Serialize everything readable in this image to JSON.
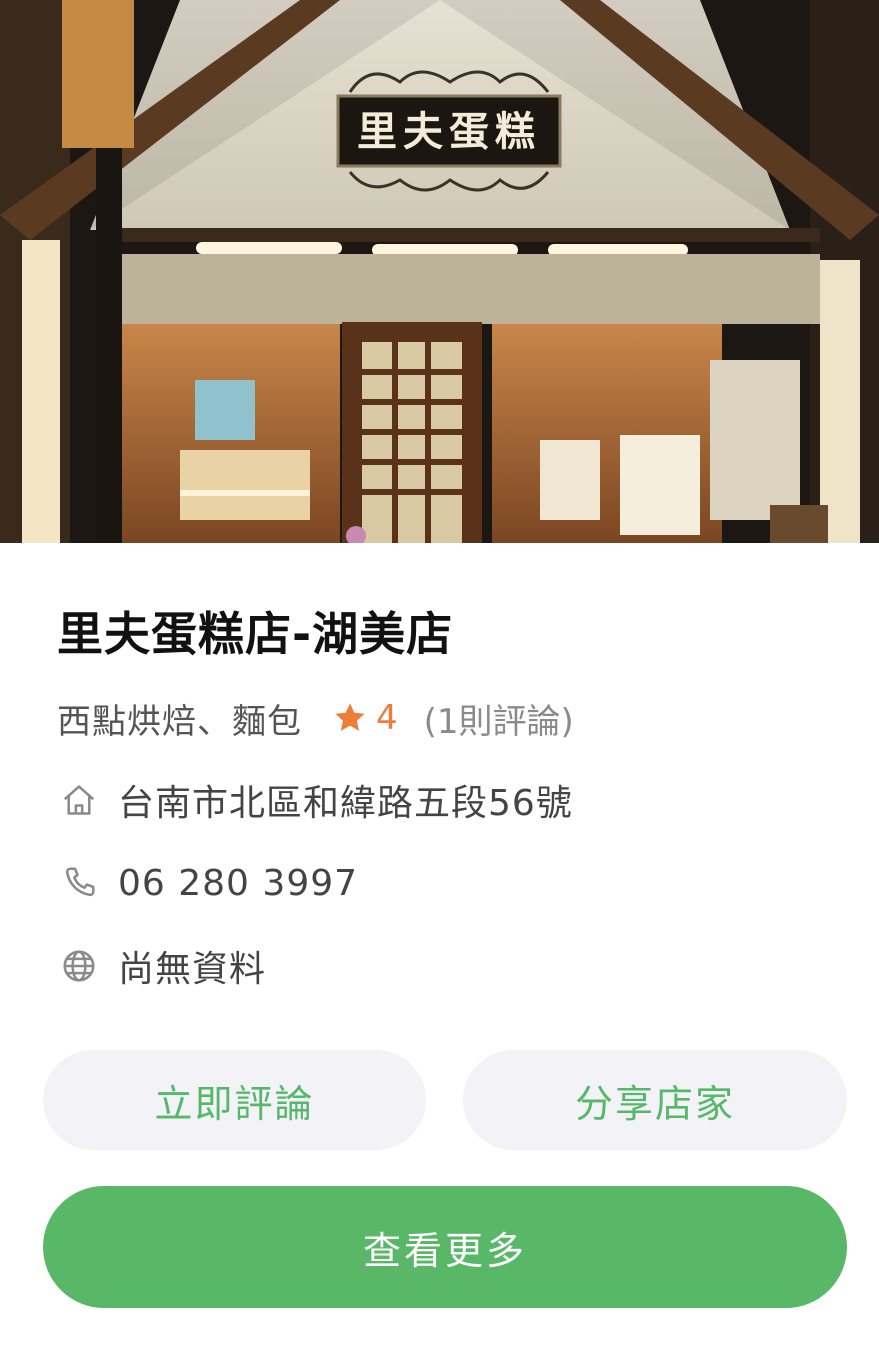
{
  "store": {
    "sign_text": "里夫蛋糕",
    "name": "里夫蛋糕店-湖美店",
    "category": "西點烘焙、麵包",
    "rating": "4",
    "review_count": "(1則評論)",
    "address": "台南市北區和緯路五段56號",
    "phone": "06 280 3997",
    "website": "尚無資料"
  },
  "actions": {
    "review_button": "立即評論",
    "share_button": "分享店家",
    "more_button": "查看更多"
  },
  "icons": {
    "rating": "star-icon",
    "address": "home-icon",
    "phone": "phone-icon",
    "website": "globe-icon"
  },
  "colors": {
    "accent_green": "#58b868",
    "green_text": "#55b86a",
    "star_orange": "#ee7d3a",
    "pill_background": "#f3f3f7"
  }
}
